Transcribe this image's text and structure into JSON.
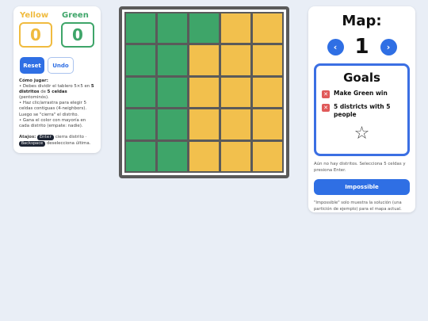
{
  "scores": {
    "yellow_label": "Yellow",
    "yellow_value": "0",
    "green_label": "Green",
    "green_value": "0"
  },
  "buttons": {
    "reset": "Reset",
    "undo": "Undo"
  },
  "howto": {
    "heading": "Cómo jugar:",
    "line1_pre": "• Debes dividir el tablero 5×5 en ",
    "line1_b1": "5 distritos",
    "line1_mid": " de ",
    "line1_b2": "5 celdas",
    "line1_post": " (pentominós).",
    "line2": "• Haz clic/arrastra para elegir 5 celdas contiguas (4-neighbors). Luego se \"cierra\" el distrito.",
    "line3": "• Gana el color con mayoría en cada distrito (empate: nadie)."
  },
  "shortcuts": {
    "label": "Atajos:",
    "key1": "Enter",
    "desc1": "cierra distrito ·",
    "key2": "Backspace",
    "desc2": "deselecciona última."
  },
  "board": {
    "colors": {
      "green": "#3ea569",
      "yellow": "#f2c04d"
    },
    "cells": [
      [
        "green",
        "green",
        "green",
        "yellow",
        "yellow"
      ],
      [
        "green",
        "green",
        "yellow",
        "yellow",
        "yellow"
      ],
      [
        "green",
        "green",
        "yellow",
        "yellow",
        "yellow"
      ],
      [
        "green",
        "green",
        "yellow",
        "yellow",
        "yellow"
      ],
      [
        "green",
        "green",
        "yellow",
        "yellow",
        "yellow"
      ]
    ]
  },
  "map": {
    "title": "Map:",
    "number": "1",
    "prev_icon": "chevron-left-icon",
    "next_icon": "chevron-right-icon"
  },
  "goals": {
    "title": "Goals",
    "items": [
      {
        "text": "Make Green win",
        "status": "unmet"
      },
      {
        "text": "5 districts with 5 people",
        "status": "unmet"
      }
    ],
    "star_icon": "star-outline-icon"
  },
  "status_text": "Aún no hay distritos. Selecciona 5 celdas y presiona Enter.",
  "impossible_label": "Impossible",
  "footnote": "\"Impossible\" solo muestra la solución (una partición de ejemplo) para el mapa actual."
}
